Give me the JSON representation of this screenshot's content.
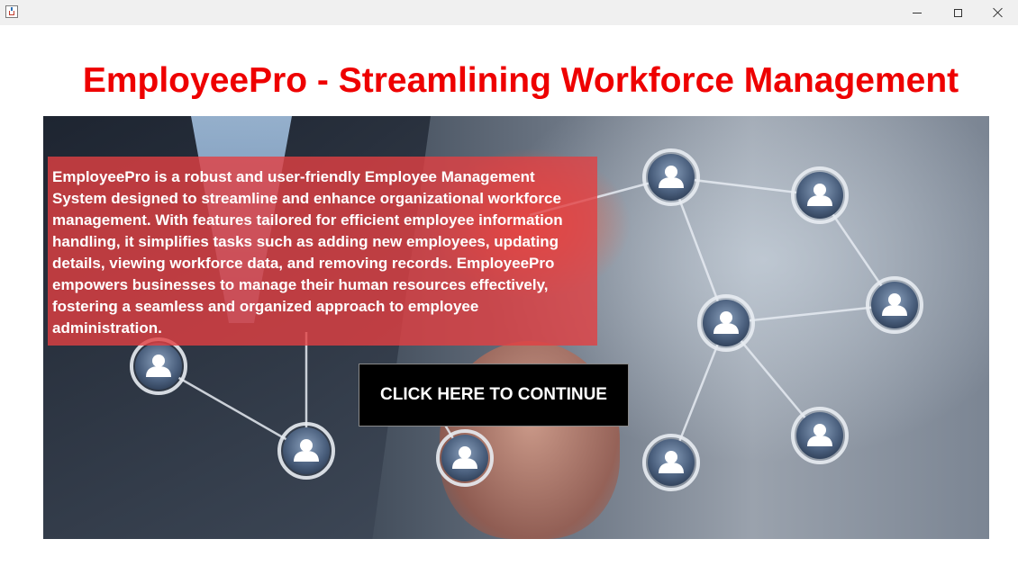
{
  "window": {
    "app_icon": "java-cup-icon",
    "controls": [
      "minimize-icon",
      "maximize-icon",
      "close-icon"
    ]
  },
  "page": {
    "title": "EmployeePro - Streamlining Workforce Management",
    "title_color": "#ee0000"
  },
  "hero": {
    "description": "EmployeePro is a robust and user-friendly Employee Management System designed to streamline and enhance organizational workforce management. With features tailored for efficient employee information handling, it simplifies tasks such as adding new employees, updating details, viewing workforce data, and removing records. EmployeePro empowers businesses to manage their human resources effectively, fostering a seamless and organized approach to employee administration.",
    "description_bg": "#e24042",
    "continue_label": "CLICK HERE TO CONTINUE",
    "network_icon": "user-node-icon"
  }
}
